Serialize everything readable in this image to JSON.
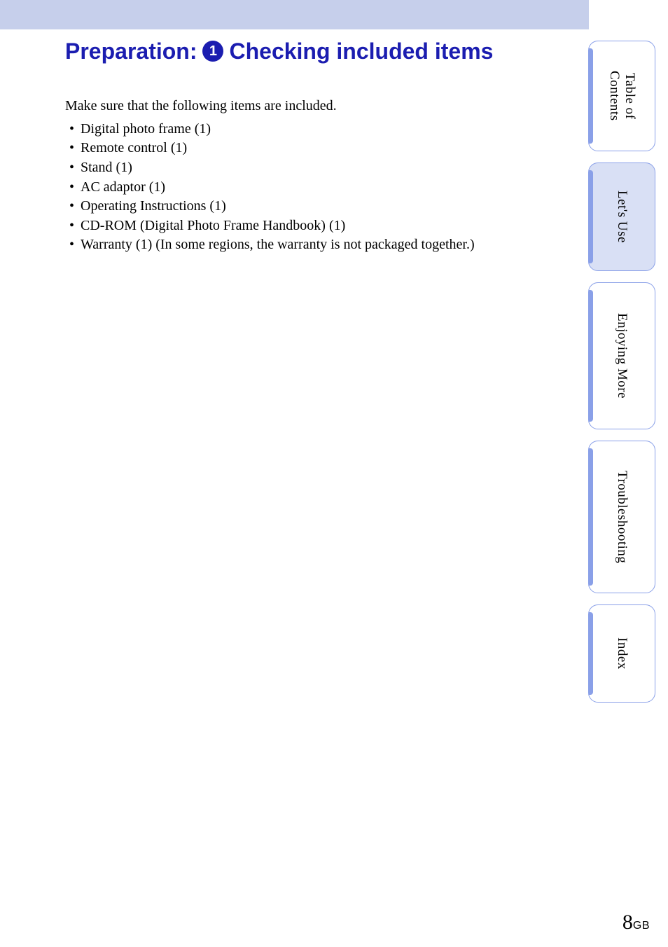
{
  "heading": {
    "prefix": "Preparation:",
    "step_number": "1",
    "suffix": "Checking included items"
  },
  "intro": "Make sure that the following items are included.",
  "items": [
    "Digital photo frame (1)",
    "Remote control (1)",
    "Stand (1)",
    "AC adaptor (1)",
    "Operating Instructions (1)",
    "CD-ROM (Digital Photo Frame Handbook) (1)",
    "Warranty (1) (In some regions, the warranty is not packaged together.)"
  ],
  "tabs": {
    "toc": "Table of\nContents",
    "lets_use": "Let's Use",
    "enjoying_more": "Enjoying More",
    "troubleshooting": "Troubleshooting",
    "index": "Index"
  },
  "page": {
    "number": "8",
    "suffix": "GB"
  }
}
